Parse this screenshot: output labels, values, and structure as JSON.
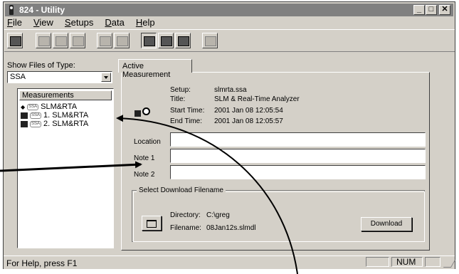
{
  "window": {
    "title": "824 - Utility"
  },
  "menu": {
    "items": [
      "File",
      "View",
      "Setups",
      "Data",
      "Help"
    ]
  },
  "left_pane": {
    "show_files_label": "Show Files of Type:",
    "file_type_value": "SSA",
    "measurements_header": "Measurements",
    "items": [
      {
        "badge": "SSA",
        "label": "SLM&RTA"
      },
      {
        "badge": "SSA",
        "label": "1. SLM&RTA"
      },
      {
        "badge": "SSA",
        "label": "2. SLM&RTA"
      }
    ]
  },
  "tab": {
    "label": "Active Measurement"
  },
  "details": {
    "setup_label": "Setup:",
    "setup_value": "slmrta.ssa",
    "title_label": "Title:",
    "title_value": "SLM & Real-Time Analyzer",
    "start_label": "Start Time:",
    "start_value": "2001 Jan 08 12:05:54",
    "end_label": "End Time:",
    "end_value": "2001 Jan 08 12:05:57"
  },
  "fields": {
    "location_label": "Location",
    "note1_label": "Note 1",
    "note2_label": "Note 2",
    "location_value": "",
    "note1_value": "",
    "note2_value": ""
  },
  "download": {
    "group_label": "Select Download Filename",
    "directory_label": "Directory:",
    "directory_value": "C:\\greg",
    "filename_label": "Filename:",
    "filename_value": "08Jan12s.slmdl",
    "download_button": "Download"
  },
  "status": {
    "help_text": "For Help, press F1",
    "num_indicator": "NUM"
  }
}
